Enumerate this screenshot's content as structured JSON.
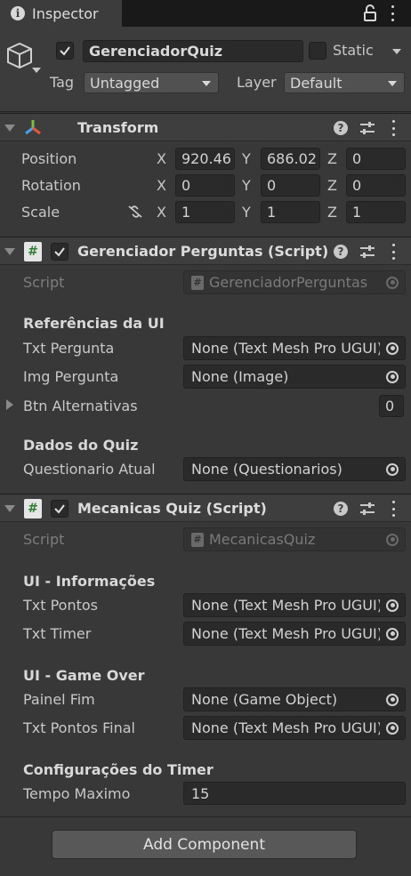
{
  "tab": {
    "title": "Inspector"
  },
  "header": {
    "object_name": "GerenciadorQuiz",
    "static_label": "Static",
    "tag_label": "Tag",
    "tag_value": "Untagged",
    "layer_label": "Layer",
    "layer_value": "Default"
  },
  "transform": {
    "title": "Transform",
    "position": {
      "label": "Position",
      "x": "920.46",
      "y": "686.02",
      "z": "0"
    },
    "rotation": {
      "label": "Rotation",
      "x": "0",
      "y": "0",
      "z": "0"
    },
    "scale": {
      "label": "Scale",
      "x": "1",
      "y": "1",
      "z": "1"
    },
    "axis_x": "X",
    "axis_y": "Y",
    "axis_z": "Z"
  },
  "gerenciador": {
    "title": "Gerenciador Perguntas (Script)",
    "script_label": "Script",
    "script_value": "GerenciadorPerguntas",
    "section_ui": "Referências da UI",
    "txt_pergunta_label": "Txt Pergunta",
    "txt_pergunta_value": "None (Text Mesh Pro UGUI)",
    "img_pergunta_label": "Img Pergunta",
    "img_pergunta_value": "None (Image)",
    "btn_alternativas_label": "Btn Alternativas",
    "btn_alternativas_count": "0",
    "section_dados": "Dados do Quiz",
    "questionario_label": "Questionario Atual",
    "questionario_value": "None (Questionarios)"
  },
  "mecanicas": {
    "title": "Mecanicas Quiz (Script)",
    "script_label": "Script",
    "script_value": "MecanicasQuiz",
    "section_info": "UI - Informações",
    "txt_pontos_label": "Txt Pontos",
    "txt_pontos_value": "None (Text Mesh Pro UGUI)",
    "txt_timer_label": "Txt Timer",
    "txt_timer_value": "None (Text Mesh Pro UGUI)",
    "section_gameover": "UI - Game Over",
    "painel_fim_label": "Painel Fim",
    "painel_fim_value": "None (Game Object)",
    "txt_pontos_final_label": "Txt Pontos Final",
    "txt_pontos_final_value": "None (Text Mesh Pro UGUI)",
    "section_timer": "Configurações do Timer",
    "tempo_label": "Tempo Maximo",
    "tempo_value": "15"
  },
  "add_component": "Add Component",
  "help_glyph": "?",
  "script_glyph": "#",
  "info_glyph": "i"
}
